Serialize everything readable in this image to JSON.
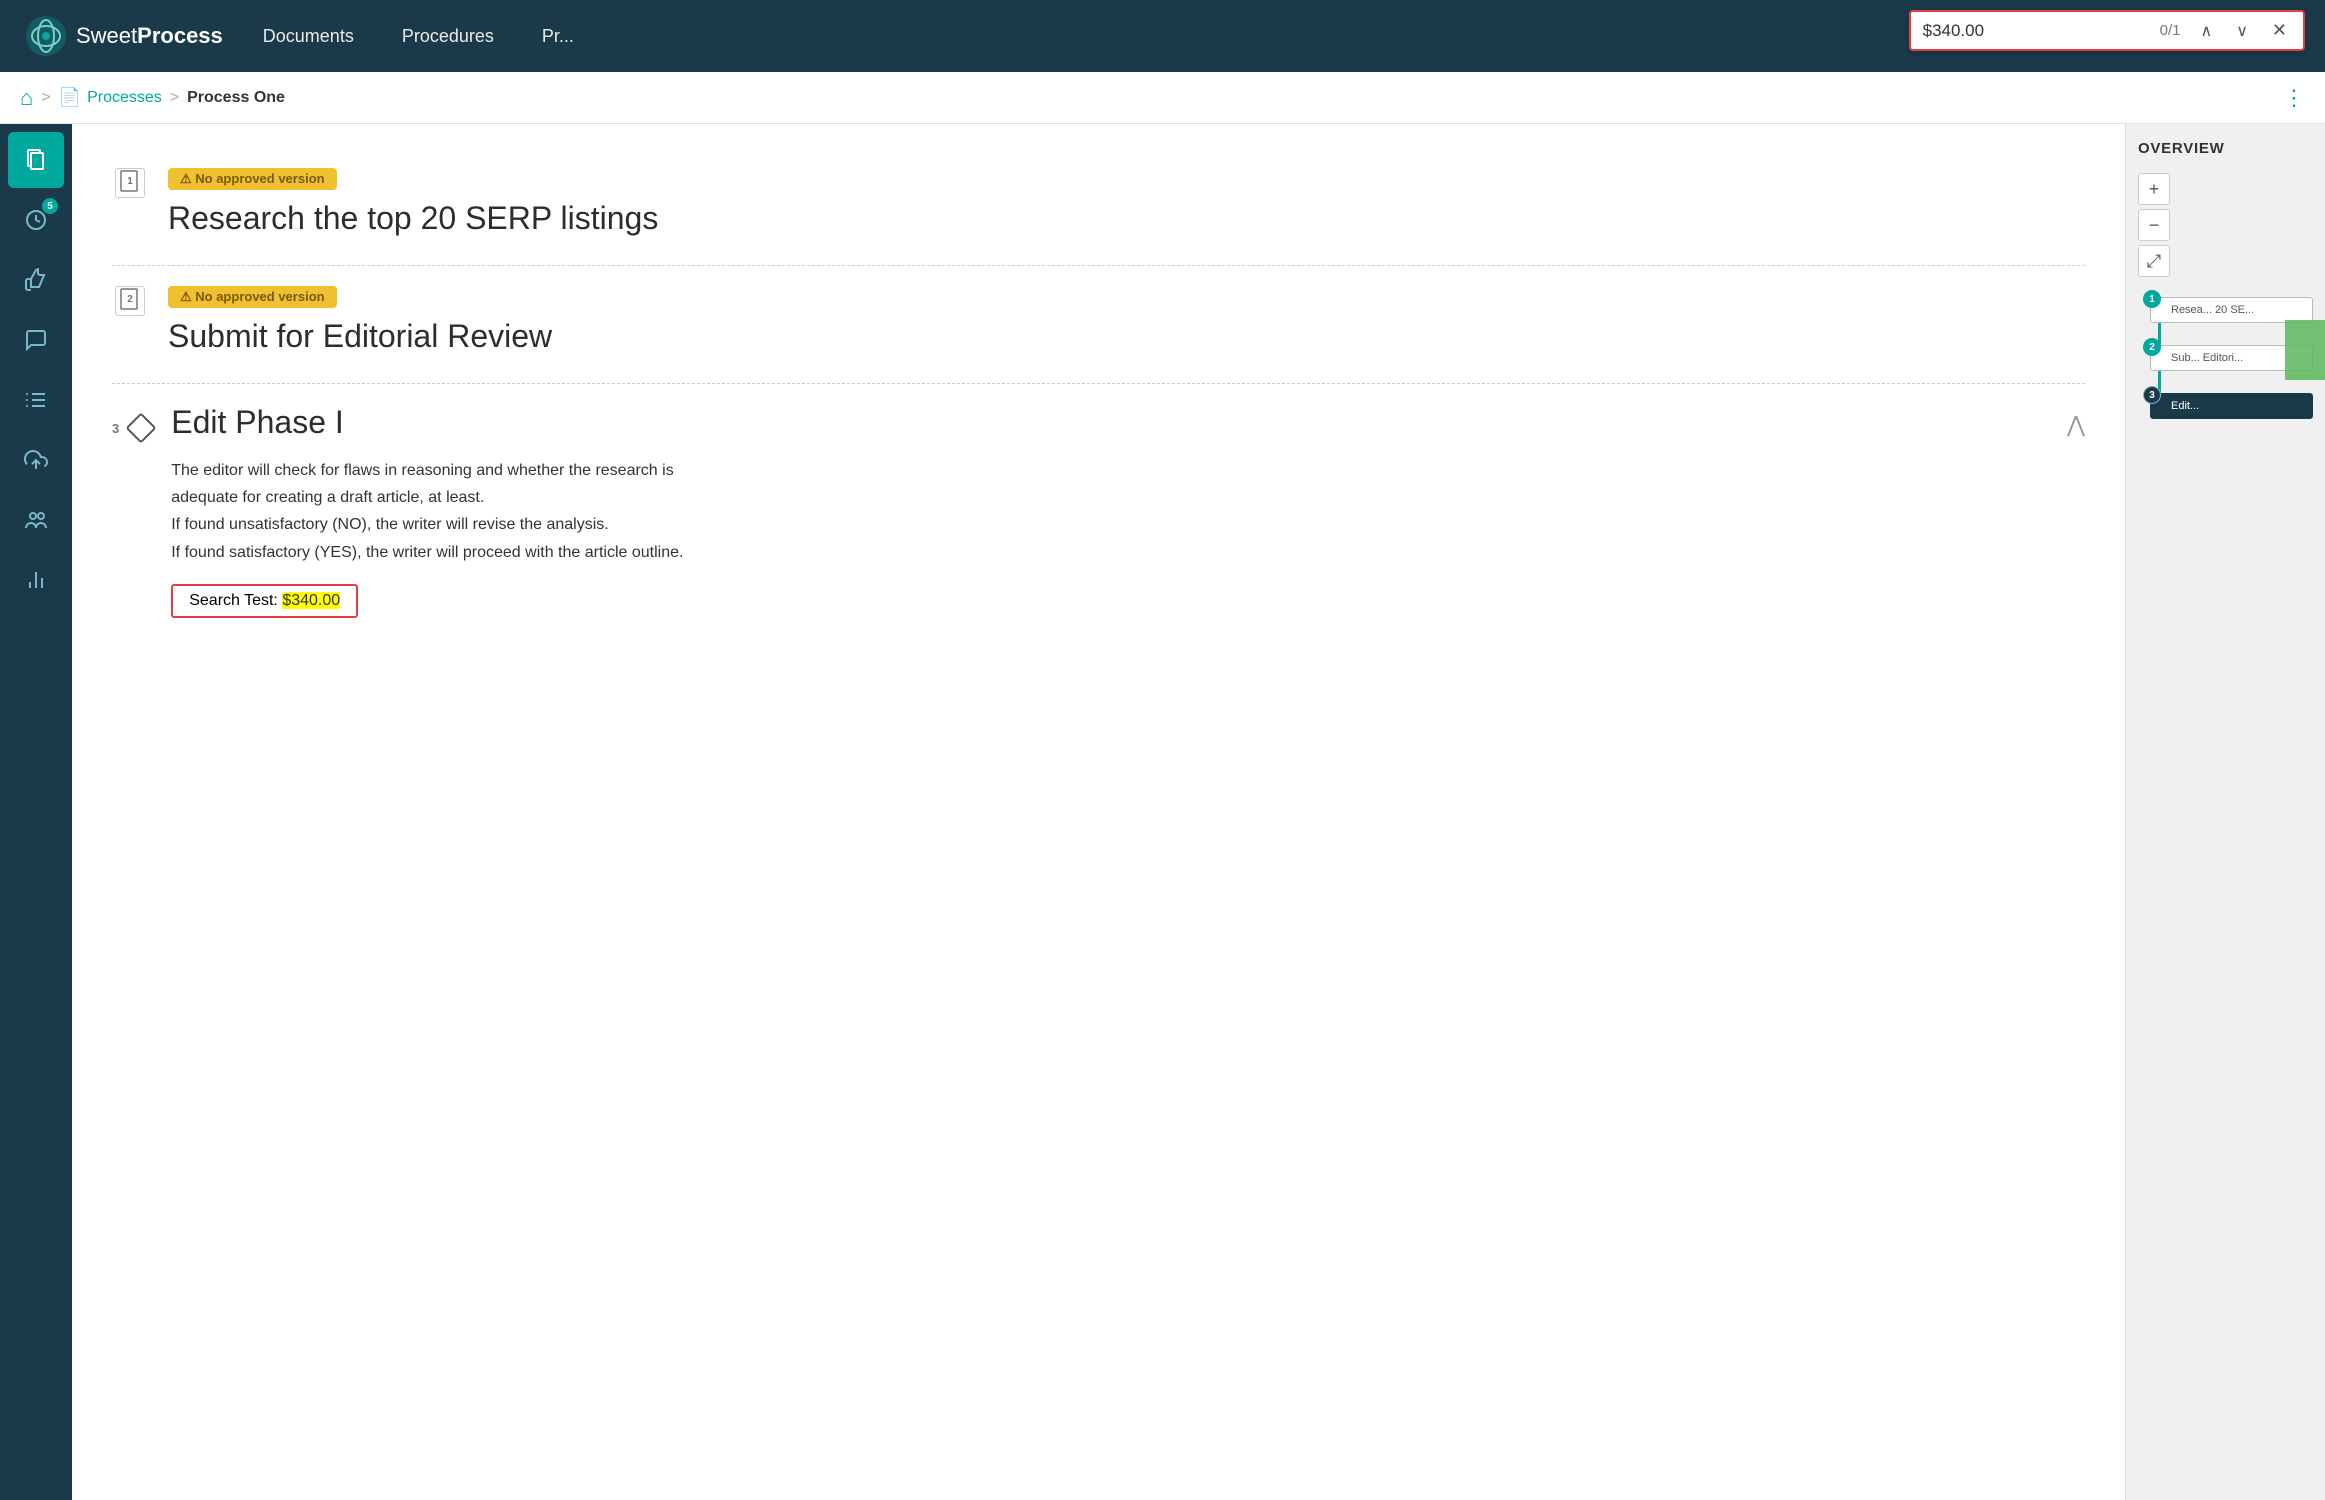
{
  "browser": {
    "url": "sweetprocess.com/groups/ps-fipMsy/process-one/..."
  },
  "nav": {
    "logo_sweet": "Sweet",
    "logo_process": "Process",
    "links": [
      "Documents",
      "Procedures",
      "Pr..."
    ]
  },
  "findbar": {
    "query": "$340.00",
    "count": "0/1",
    "prev_label": "▲",
    "next_label": "▼",
    "close_label": "×"
  },
  "breadcrumb": {
    "home_icon": "⌂",
    "processes_label": "Processes",
    "separator": ">",
    "current": "Process One",
    "more_icon": "⋮"
  },
  "sidebar": {
    "items": [
      {
        "icon": "📋",
        "label": "documents",
        "active": true
      },
      {
        "icon": "🕐",
        "label": "recent",
        "badge": "5"
      },
      {
        "icon": "👍",
        "label": "approvals"
      },
      {
        "icon": "💬",
        "label": "comments"
      },
      {
        "icon": "☰",
        "label": "list"
      },
      {
        "icon": "☁",
        "label": "upload"
      },
      {
        "icon": "👥",
        "label": "team"
      },
      {
        "icon": "📊",
        "label": "reports"
      }
    ]
  },
  "steps": [
    {
      "number": "1",
      "badge": "⚠ No approved version",
      "title": "Research the top 20 SERP listings",
      "type": "document"
    },
    {
      "number": "2",
      "badge": "⚠ No approved version",
      "title": "Submit for Editorial Review",
      "type": "document"
    },
    {
      "number": "3",
      "title": "Edit Phase I",
      "type": "decision",
      "body_lines": [
        "The editor will check for flaws in reasoning and whether the research is",
        "adequate for creating a draft article, at least.",
        "If found unsatisfactory (NO), the writer will revise the analysis.",
        "If found satisfactory (YES), the writer will proceed with the article outline."
      ],
      "search_test_label": "Search Test: ",
      "search_test_value": "$340.00"
    }
  ],
  "overview": {
    "title": "OVERVIEW",
    "zoom_in": "+",
    "zoom_out": "−",
    "fit": "⤢",
    "nodes": [
      {
        "num": "1",
        "text": "Resea... 20 SE..."
      },
      {
        "num": "2",
        "text": "Sub... Editori..."
      },
      {
        "num": "3",
        "text": "Edit...",
        "dark": true
      }
    ]
  }
}
